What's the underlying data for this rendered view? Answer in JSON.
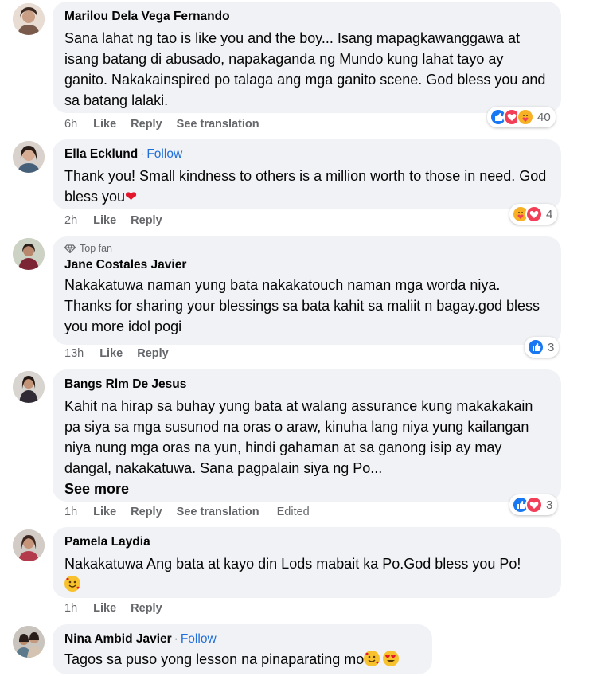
{
  "comments": [
    {
      "author": "Marilou Dela Vega Fernando",
      "text": "Sana lahat ng tao is like you and the boy... Isang mapagkawanggawa at isang batang di abusado, napakaganda ng Mundo kung lahat tayo ay ganito. Nakakainspired po talaga ang mga ganito scene. God bless you and sa batang lalaki.",
      "time": "6h",
      "like": "Like",
      "reply": "Reply",
      "see_translation": "See translation",
      "reaction_count": "40",
      "reaction_icons": [
        "like-icon",
        "love-icon",
        "care-icon"
      ]
    },
    {
      "author": "Ella Ecklund",
      "separator": "·",
      "follow": "Follow",
      "text": "Thank you! Small kindness to others is a million worth to those in need. God bless you",
      "trailing_emoji": "heart",
      "time": "2h",
      "like": "Like",
      "reply": "Reply",
      "reaction_count": "4",
      "reaction_icons": [
        "care-icon",
        "love-icon"
      ]
    },
    {
      "badge": "Top fan",
      "badge_icon": "diamond-icon",
      "author": "Jane Costales Javier",
      "text": "Nakakatuwa naman yung bata nakakatouch naman mga worda niya. Thanks for sharing your blessings sa bata kahit sa maliit n bagay.god bless you more idol pogi",
      "time": "13h",
      "like": "Like",
      "reply": "Reply",
      "reaction_count": "3",
      "reaction_icons": [
        "like-icon"
      ]
    },
    {
      "author": "Bangs Rlm De Jesus",
      "text": "Kahit na hirap sa buhay yung bata at walang assurance kung makakakain pa siya sa mga susunod na oras o araw, kinuha lang niya yung kailangan niya nung mga oras na yun, hindi gahaman at sa ganong isip ay may dangal, nakakatuwa. Sana pagpalain siya ng Po...",
      "see_more": "See more",
      "time": "1h",
      "like": "Like",
      "reply": "Reply",
      "see_translation": "See translation",
      "edited": "Edited",
      "reaction_count": "3",
      "reaction_icons": [
        "like-icon",
        "love-icon"
      ]
    },
    {
      "author": "Pamela Laydia",
      "text": "Nakakatuwa Ang bata at kayo din Lods mabait ka Po.God bless you Po!",
      "trailing_emoji": "smiling-face-with-hearts",
      "time": "1h",
      "like": "Like",
      "reply": "Reply"
    },
    {
      "author": "Nina Ambid Javier",
      "separator": "·",
      "follow": "Follow",
      "text": "Tagos sa puso yong lesson na pinaparating mo",
      "trailing_emoji": "smiling-face-with-hearts, heart-eyes",
      "time": "",
      "like": "",
      "reply": ""
    }
  ],
  "colors": {
    "bubble": "#f0f2f5",
    "follow_link": "#216fdb",
    "meta_text": "#65676b",
    "like_blue": "#1877f2",
    "love_red": "#f33e58",
    "care_yellow": "#f7b125"
  }
}
